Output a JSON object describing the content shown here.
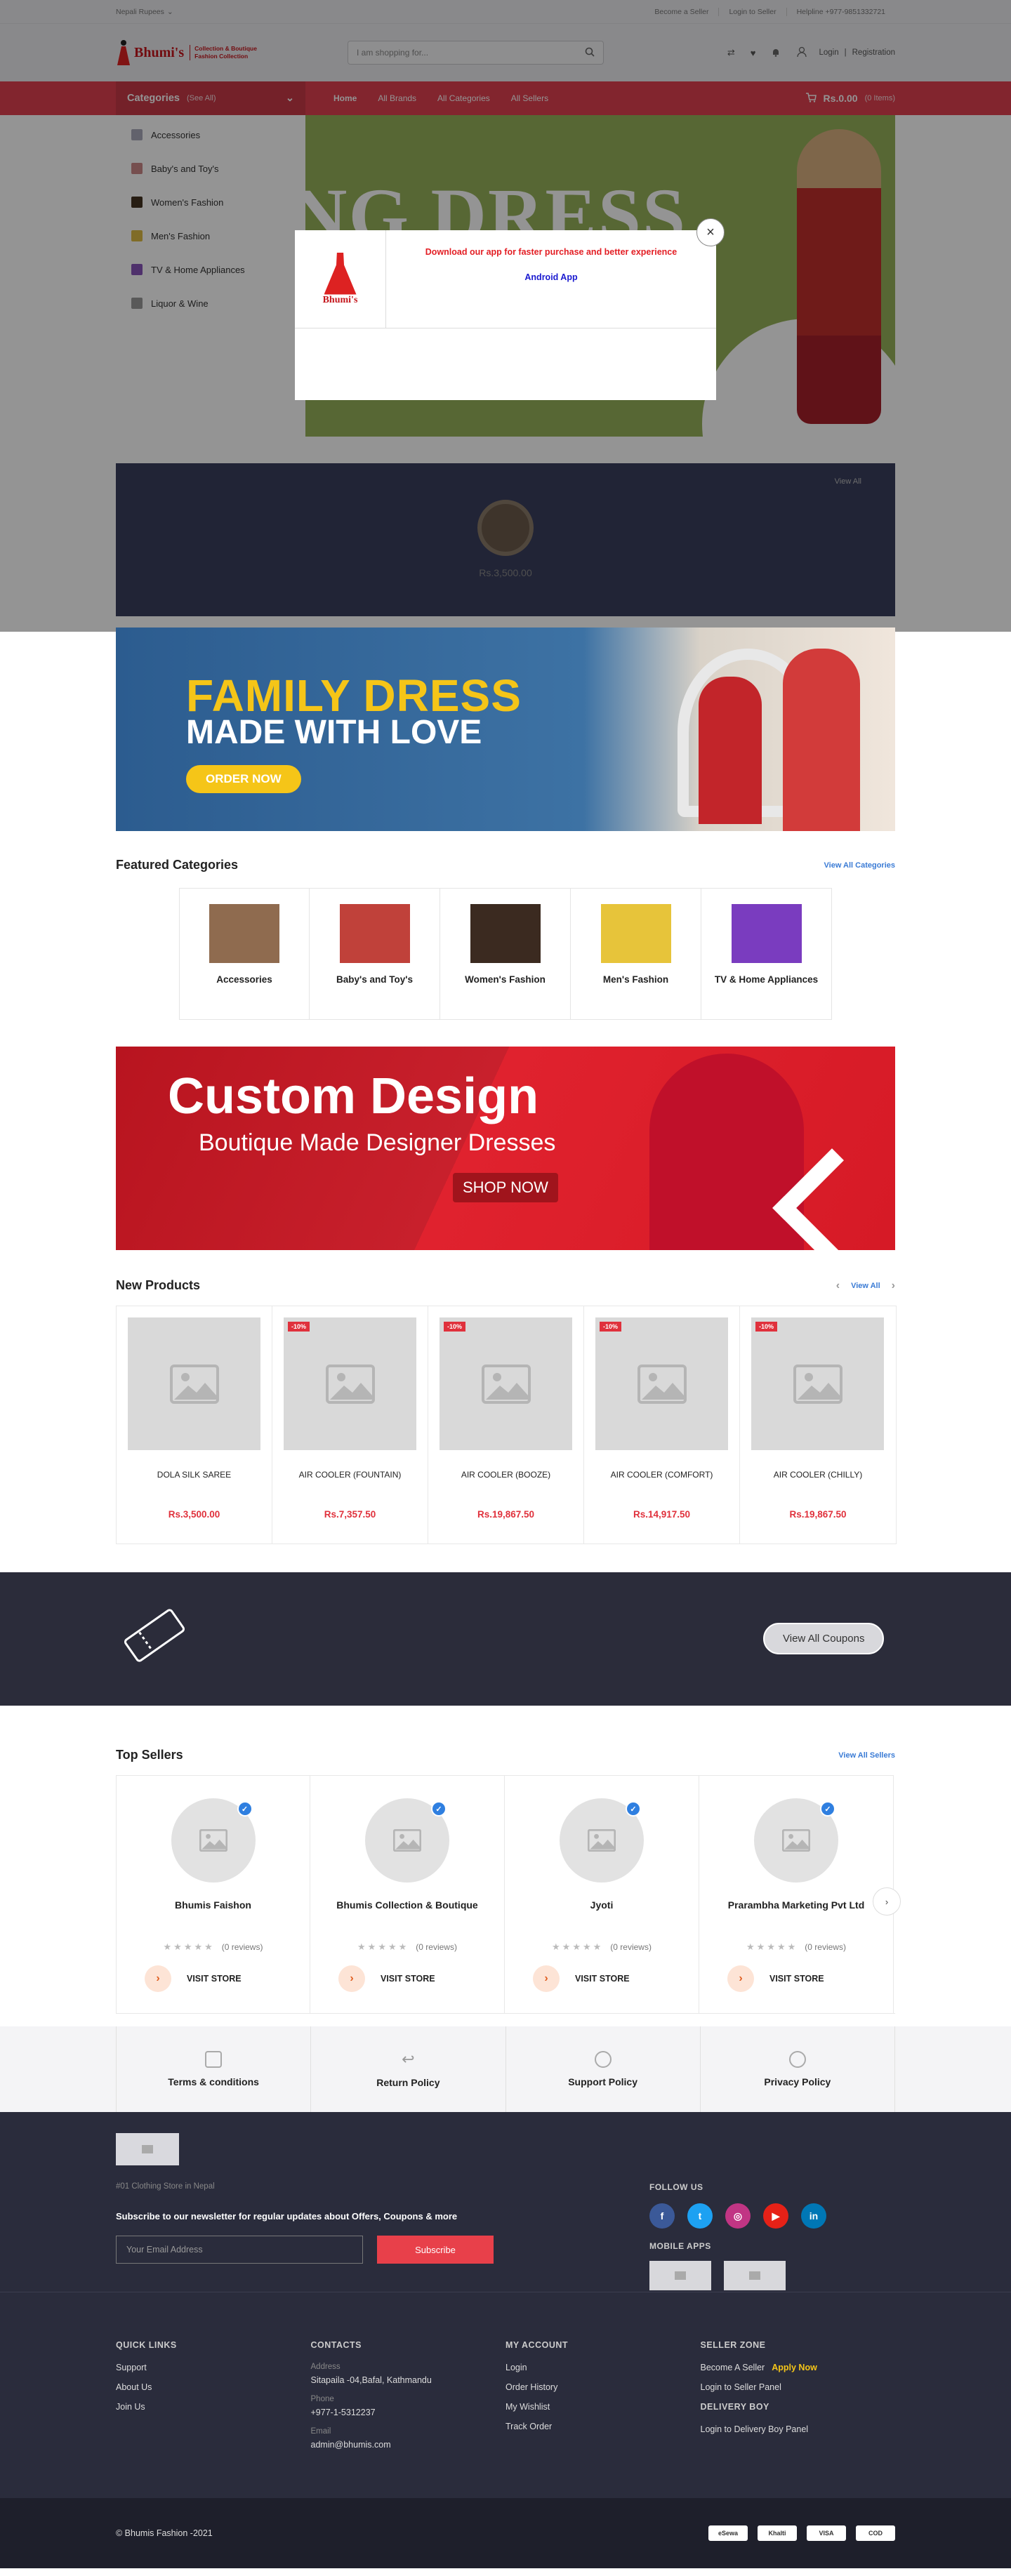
{
  "topbar": {
    "language": "Nepali Rupees",
    "links": [
      "Become a Seller",
      "Login to Seller",
      "Helpline +977-9851332721"
    ]
  },
  "header": {
    "logo_name": "Bhumi's",
    "logo_tagline_1": "Collection & Boutique",
    "logo_tagline_2": "Fashion Collection",
    "search_placeholder": "I am shopping for...",
    "login": "Login",
    "register": "Registration"
  },
  "nav": {
    "categories_label": "Categories",
    "see_all": "(See All)",
    "links": [
      "Home",
      "All Brands",
      "All Categories",
      "All Sellers"
    ],
    "cart_total": "Rs.0.00",
    "cart_items": "(0 Items)"
  },
  "sidebar_categories": [
    "Accessories",
    "Baby's and Toy's",
    "Women's Fashion",
    "Men's Fashion",
    "TV & Home Appliances",
    "Liquor & Wine"
  ],
  "hero": {
    "text": "NG DRESS"
  },
  "deal": {
    "view_all": "View All",
    "price": "Rs.3,500.00"
  },
  "modal": {
    "logo_text": "Bhumi's",
    "message": "Download our app for faster purchase and better experience",
    "android": "Android App",
    "close": "×"
  },
  "family_banner": {
    "line1": "FAMILY DRESS",
    "line2": "MADE WITH LOVE",
    "button": "ORDER NOW"
  },
  "featured": {
    "title": "Featured Categories",
    "view_all": "View All Categories",
    "items": [
      "Accessories",
      "Baby's and Toy's",
      "Women's Fashion",
      "Men's Fashion",
      "TV & Home Appliances"
    ],
    "colors": [
      "#8f6b4f",
      "#c0413a",
      "#3b2a20",
      "#e7c43a",
      "#7a3cbf"
    ]
  },
  "custom_banner": {
    "line1": "Custom Design",
    "line2": "Boutique Made Designer Dresses",
    "button": "SHOP NOW"
  },
  "new_products": {
    "title": "New Products",
    "view_all": "View All",
    "items": [
      {
        "name": "DOLA SILK SAREE",
        "price": "Rs.3,500.00",
        "discount": ""
      },
      {
        "name": "AIR COOLER (FOUNTAIN)",
        "price": "Rs.7,357.50",
        "discount": "-10%"
      },
      {
        "name": "AIR COOLER (BOOZE)",
        "price": "Rs.19,867.50",
        "discount": "-10%"
      },
      {
        "name": "AIR COOLER (COMFORT)",
        "price": "Rs.14,917.50",
        "discount": "-10%"
      },
      {
        "name": "AIR COOLER (CHILLY)",
        "price": "Rs.19,867.50",
        "discount": "-10%"
      }
    ]
  },
  "coupons": {
    "button": "View All Coupons"
  },
  "top_sellers": {
    "title": "Top Sellers",
    "view_all": "View All Sellers",
    "reviews": "(0 reviews)",
    "visit": "VISIT STORE",
    "items": [
      "Bhumis Faishon",
      "Bhumis Collection & Boutique",
      "Jyoti",
      "Prarambha Marketing Pvt Ltd"
    ]
  },
  "policies": [
    "Terms & conditions",
    "Return Policy",
    "Support Policy",
    "Privacy Policy"
  ],
  "footer": {
    "tagline": "#01 Clothing Store in Nepal",
    "newsletter": "Subscribe to our newsletter for regular updates about Offers, Coupons & more",
    "email_placeholder": "Your Email Address",
    "subscribe": "Subscribe",
    "follow_us": "FOLLOW US",
    "mobile_apps": "MOBILE APPS",
    "social": [
      {
        "l": "f",
        "c": "#3b5998"
      },
      {
        "l": "t",
        "c": "#1da1f2"
      },
      {
        "l": "◎",
        "c": "#c13584"
      },
      {
        "l": "▶",
        "c": "#e62117"
      },
      {
        "l": "in",
        "c": "#0077b5"
      }
    ],
    "quick_links": {
      "title": "QUICK LINKS",
      "items": [
        "Support",
        "About Us",
        "Join Us"
      ]
    },
    "contacts": {
      "title": "CONTACTS",
      "address_label": "Address",
      "address": "Sitapaila -04,Bafal, Kathmandu",
      "phone_label": "Phone",
      "phone": "+977-1-5312237",
      "email_label": "Email",
      "email": "admin@bhumis.com"
    },
    "my_account": {
      "title": "MY ACCOUNT",
      "items": [
        "Login",
        "Order History",
        "My Wishlist",
        "Track Order"
      ]
    },
    "seller_zone": {
      "title": "SELLER ZONE",
      "become": "Become A Seller",
      "apply": "Apply Now",
      "login": "Login to Seller Panel"
    },
    "delivery_boy": {
      "title": "DELIVERY BOY",
      "login": "Login to Delivery Boy Panel"
    },
    "copyright": "© Bhumis Fashion -2021",
    "payments": [
      "eSewa",
      "Khalti",
      "VISA",
      "COD"
    ]
  }
}
